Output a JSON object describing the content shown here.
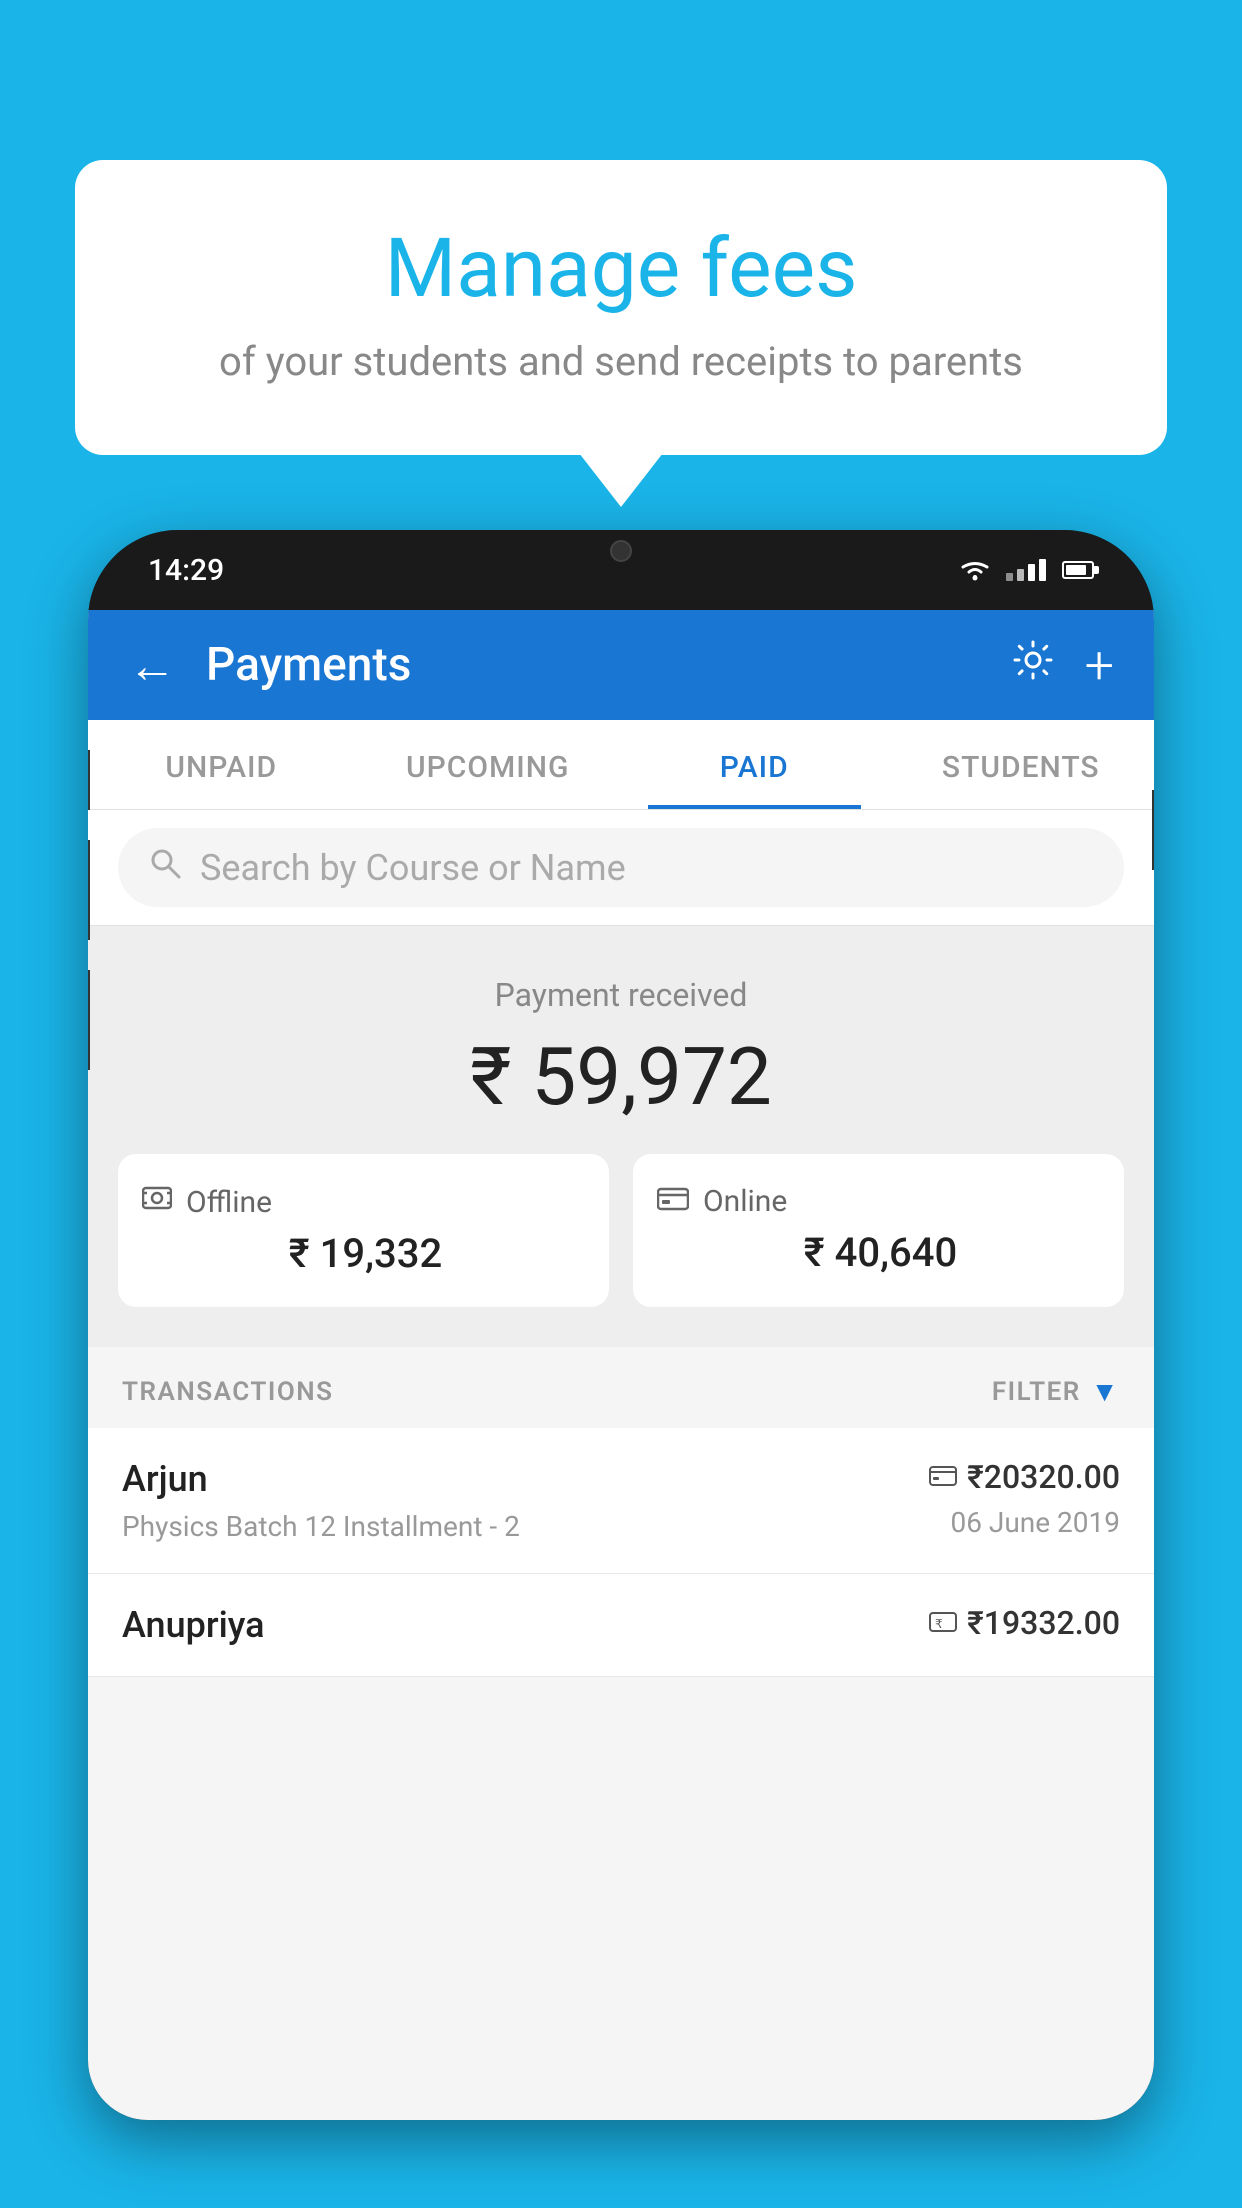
{
  "hero": {
    "title": "Manage fees",
    "subtitle": "of your students and send receipts to parents"
  },
  "phone": {
    "status_bar": {
      "time": "14:29"
    },
    "header": {
      "title": "Payments",
      "back_label": "←",
      "settings_label": "⚙",
      "add_label": "+"
    },
    "tabs": [
      {
        "label": "UNPAID",
        "active": false
      },
      {
        "label": "UPCOMING",
        "active": false
      },
      {
        "label": "PAID",
        "active": true
      },
      {
        "label": "STUDENTS",
        "active": false
      }
    ],
    "search": {
      "placeholder": "Search by Course or Name"
    },
    "payment_summary": {
      "label": "Payment received",
      "total": "₹ 59,972",
      "offline_label": "Offline",
      "offline_amount": "₹ 19,332",
      "online_label": "Online",
      "online_amount": "₹ 40,640"
    },
    "transactions": {
      "header_label": "TRANSACTIONS",
      "filter_label": "FILTER",
      "rows": [
        {
          "name": "Arjun",
          "detail": "Physics Batch 12 Installment - 2",
          "amount": "₹20320.00",
          "date": "06 June 2019",
          "payment_type": "card"
        },
        {
          "name": "Anupriya",
          "detail": "",
          "amount": "₹19332.00",
          "date": "",
          "payment_type": "offline"
        }
      ]
    }
  }
}
